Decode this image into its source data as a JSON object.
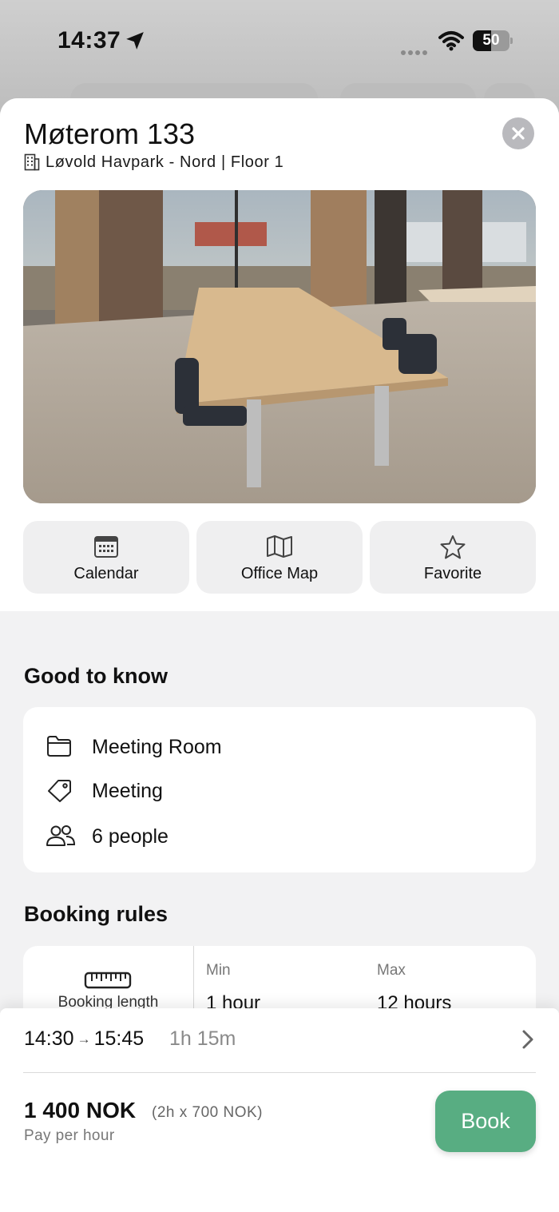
{
  "status_bar": {
    "time": "14:37",
    "battery": "50",
    "battery_level_percent": 50
  },
  "room": {
    "title": "Møterom 133",
    "subtitle": "Løvold Havpark - Nord | Floor 1"
  },
  "actions": [
    {
      "label": "Calendar",
      "icon": "calendar-icon"
    },
    {
      "label": "Office Map",
      "icon": "map-icon"
    },
    {
      "label": "Favorite",
      "icon": "star-icon"
    }
  ],
  "good_to_know": {
    "title": "Good to know",
    "items": [
      {
        "icon": "folder-icon",
        "label": "Meeting Room"
      },
      {
        "icon": "tag-icon",
        "label": "Meeting"
      },
      {
        "icon": "people-icon",
        "label": "6 people"
      }
    ]
  },
  "booking_rules": {
    "title": "Booking rules",
    "rule_label": "Booking length",
    "min_label": "Min",
    "min_value": "1 hour",
    "max_label": "Max",
    "max_value": "12 hours"
  },
  "booking": {
    "start": "14:30",
    "arrow": "→",
    "end": "15:45",
    "duration": "1h 15m",
    "price": "1 400 NOK",
    "price_detail": "(2h x 700 NOK)",
    "pay_note": "Pay per hour",
    "book_label": "Book"
  },
  "colors": {
    "accent": "#58ad82",
    "sheet_bg": "#f2f2f3"
  }
}
